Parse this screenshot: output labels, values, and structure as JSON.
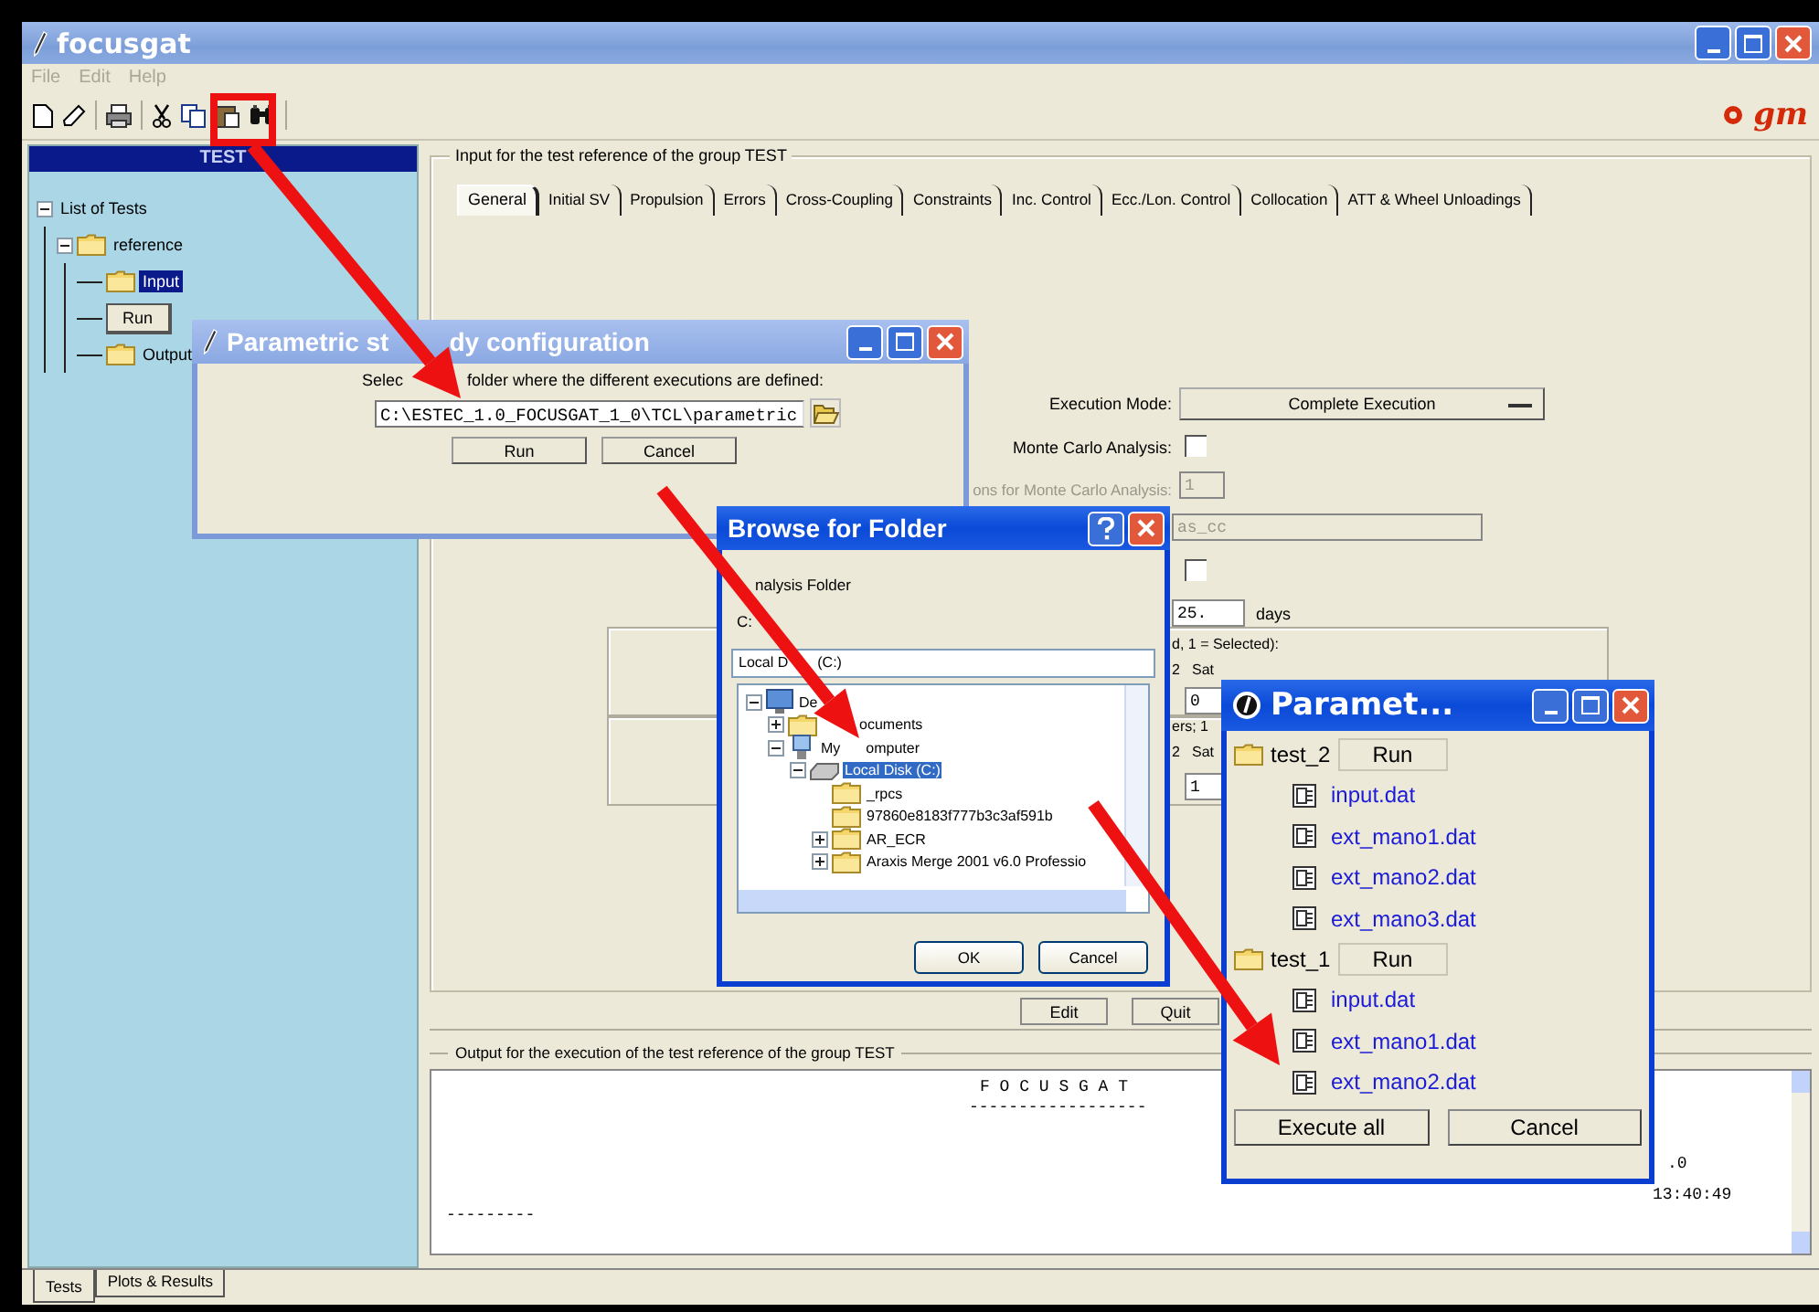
{
  "window": {
    "title": "focusgat"
  },
  "menu": [
    {
      "label": "File",
      "disabled": true
    },
    {
      "label": "Edit",
      "disabled": true
    },
    {
      "label": "Help",
      "disabled": true
    }
  ],
  "logo": "gm",
  "tree": {
    "header": "TEST",
    "items": [
      {
        "label": "List of Tests",
        "expanded": true,
        "selected": false,
        "children": [
          {
            "label": "reference",
            "kind": "folder",
            "expanded": true,
            "selected": false,
            "children": [
              {
                "label": "Input",
                "kind": "folder",
                "selected": true
              },
              {
                "label": "Run",
                "kind": "button"
              },
              {
                "label": "Output",
                "kind": "folder",
                "selected": false
              }
            ]
          }
        ]
      }
    ]
  },
  "input_panel": {
    "title": "Input for the test reference of the group TEST",
    "tabs": [
      {
        "label": "General",
        "selected": true
      },
      {
        "label": "Initial SV",
        "selected": false
      },
      {
        "label": "Propulsion",
        "selected": false
      },
      {
        "label": "Errors",
        "selected": false
      },
      {
        "label": "Cross-Coupling",
        "selected": false
      },
      {
        "label": "Constraints",
        "selected": false
      },
      {
        "label": "Inc. Control",
        "selected": false
      },
      {
        "label": "Ecc./Lon. Control",
        "selected": false
      },
      {
        "label": "Collocation",
        "selected": false
      },
      {
        "label": "ATT & Wheel Unloadings",
        "selected": false
      }
    ]
  },
  "form": {
    "execution_mode": {
      "label": "Execution Mode:",
      "value": "Complete Execution"
    },
    "monte_carlo": {
      "label": "Monte Carlo Analysis:",
      "checked": false
    },
    "runs": {
      "label": "ons for Monte Carlo Analysis:",
      "value": "1",
      "disabled": true
    },
    "name": {
      "value": "as_cc",
      "disabled": true
    },
    "option": {
      "checked": false
    },
    "duration": {
      "value": "25.",
      "unit": "days"
    },
    "group_1": {
      "caption": "d, 1 = Selected):",
      "column": "2",
      "label": "Sat",
      "value": "0"
    },
    "group_2": {
      "caption": "ers; 1",
      "column": "2",
      "label": "Sat",
      "value": "1"
    }
  },
  "actions": [
    "Edit",
    "Quit"
  ],
  "output": {
    "title": "Output for the execution of the test reference of the group TEST",
    "lines": [
      "F O C U S G A T",
      "------------------",
      "---------",
      ".0",
      "13:40:49"
    ]
  },
  "bottom_tabs": [
    {
      "label": "Tests",
      "selected": true
    },
    {
      "label": "Plots & Results",
      "selected": false
    }
  ],
  "config_dialog": {
    "title": "Parametric st",
    "title_tail": "dy configuration",
    "prompt": "Selec",
    "prompt_tail": "folder where the different executions are defined:",
    "path": "C:\\ESTEC_1.0_FOCUSGAT_1_0\\TCL\\parametric",
    "buttons": [
      "Run",
      "Cancel"
    ]
  },
  "browse_dialog": {
    "title": "Browse for Folder",
    "caption": "nalysis Folder",
    "path": "C:",
    "field": "Local D",
    "field_tail": "(C:)",
    "tree": [
      {
        "label": "De",
        "kind": "desktop",
        "expanded": true,
        "selected": false,
        "children": [
          {
            "label": "ocuments",
            "cut_start": true,
            "kind": "documents",
            "expanded": false,
            "selected": false
          },
          {
            "label": "My",
            "label_tail": "omputer",
            "kind": "computer",
            "expanded": true,
            "selected": false,
            "children": [
              {
                "label": "Local Disk (C:)",
                "kind": "drive",
                "expanded": true,
                "selected": true,
                "children": [
                  {
                    "label": "_rpcs",
                    "kind": "folder",
                    "selected": false
                  },
                  {
                    "label": "97860e8183f777b3c3af591b",
                    "kind": "folder",
                    "selected": false
                  },
                  {
                    "label": "AR_ECR",
                    "kind": "folder",
                    "expanded": false,
                    "selected": false
                  },
                  {
                    "label": "Araxis Merge 2001 v6.0 Professio",
                    "kind": "folder",
                    "expanded": false,
                    "selected": false
                  }
                ]
              }
            ]
          }
        ]
      }
    ],
    "buttons": [
      "OK",
      "Cancel"
    ]
  },
  "params_dialog": {
    "title": "Paramet...",
    "groups": [
      {
        "name": "test_2",
        "button": "Run",
        "files": [
          "input.dat",
          "ext_mano1.dat",
          "ext_mano2.dat",
          "ext_mano3.dat"
        ]
      },
      {
        "name": "test_1",
        "button": "Run",
        "files": [
          "input.dat",
          "ext_mano1.dat",
          "ext_mano2.dat"
        ]
      }
    ],
    "buttons": [
      "Execute all",
      "Cancel"
    ]
  }
}
